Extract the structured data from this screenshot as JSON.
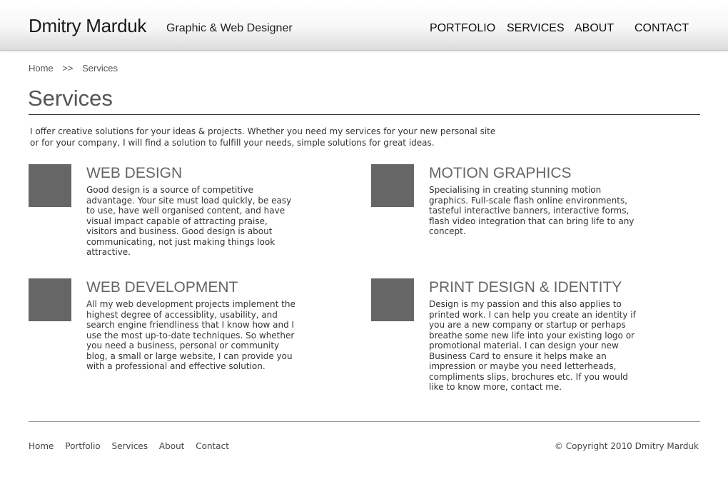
{
  "header": {
    "name": "Dmitry Marduk",
    "tagline": "Graphic & Web Designer",
    "nav": [
      "PORTFOLIO",
      "SERVICES",
      "ABOUT",
      "CONTACT"
    ]
  },
  "breadcrumb": {
    "home": "Home",
    "separator": ">>",
    "current": "Services"
  },
  "page": {
    "title": "Services",
    "intro_line1": "I offer creative solutions for your ideas & projects. Whether you need my services for your new personal site",
    "intro_line2": "or for your company, I will find a solution to fulfill your needs, simple solutions for great ideas."
  },
  "services": [
    {
      "title": "WEB DESIGN",
      "body": "Good design is a source of competitive advantage. Your site must load quickly, be easy to use, have well organised content, and have visual impact capable of attracting praise, visitors and business. Good design is about communicating, not just making things look attractive."
    },
    {
      "title": "MOTION GRAPHICS",
      "body": "Specialising in creating stunning motion graphics. Full-scale flash online environments, tasteful interactive banners, interactive forms, flash video integration that can bring life to any concept."
    },
    {
      "title": "WEB DEVELOPMENT",
      "body": "All my web development projects implement the highest degree of accessiblity, usability, and search engine friendliness that I know how and I use the most up-to-date techniques. So whether you need a business, personal or community blog, a small or large website, I can provide you with a professional and effective solution."
    },
    {
      "title": "PRINT DESIGN & IDENTITY",
      "body": "Design is my passion and this also applies to printed work.  I can help you create an identity if you are a new company or startup or perhaps breathe some new life into your existing logo or promotional material. I can design your new Business Card to ensure it helps make an impression or maybe you need letterheads, compliments slips, brochures  etc. If you would like to know more, contact me."
    }
  ],
  "footer": {
    "links": [
      "Home",
      "Portfolio",
      "Services",
      "About",
      "Contact"
    ],
    "copyright": "© Copyright 2010 Dmitry Marduk"
  },
  "colors": {
    "thumb": "#666666",
    "heading": "#666666"
  }
}
